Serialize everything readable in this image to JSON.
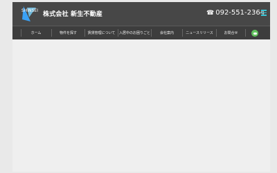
{
  "site": {
    "company_name": "株式会社 新生不動産",
    "logo_text": "SHINSEI",
    "phone_number": "092-551-2364"
  },
  "navigation": {
    "items": [
      {
        "label": "ホーム"
      },
      {
        "label": "物件を探す"
      },
      {
        "label": "賃貸管理について"
      },
      {
        "label": "入居中のお困りごと"
      },
      {
        "label": "会社案内"
      },
      {
        "label": "ニュースリリース"
      },
      {
        "label": "お問合せ"
      }
    ]
  },
  "colors": {
    "header_bg": "#474747",
    "nav_bg": "#3d3d3d",
    "content_bg": "#efefef",
    "menu_icon": "#35c7d8",
    "chat_icon": "#61c25d"
  },
  "icons": {
    "phone": "phone-icon",
    "menu": "hamburger-menu-icon",
    "chat": "line-chat-icon"
  }
}
